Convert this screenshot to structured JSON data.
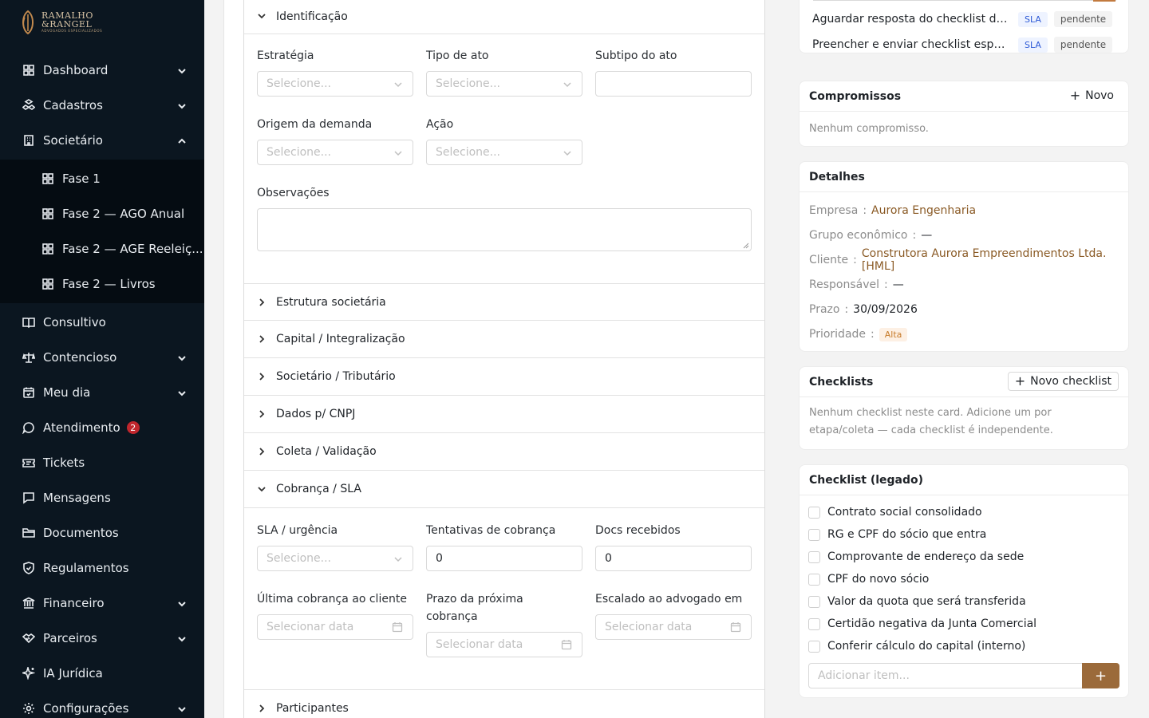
{
  "brand": {
    "name_line1": "RAMALHO",
    "name_line2": "&RANGEL",
    "tagline": "ADVOGADOS ESPECIALIZADOS"
  },
  "sidebar": {
    "items": [
      {
        "label": "Dashboard",
        "icon": "grid-icon",
        "chevron": "down"
      },
      {
        "label": "Cadastros",
        "icon": "boxes-icon",
        "chevron": "down"
      },
      {
        "label": "Societário",
        "icon": "building-icon",
        "chevron": "up"
      },
      {
        "label": "Fase 1",
        "icon": "grid-icon",
        "sub": true
      },
      {
        "label": "Fase 2 — AGO Anual",
        "icon": "grid-icon",
        "sub": true
      },
      {
        "label": "Fase 2 — AGE Reeleiç...",
        "icon": "grid-icon",
        "sub": true
      },
      {
        "label": "Fase 2 — Livros",
        "icon": "grid-icon",
        "sub": true
      },
      {
        "label": "Consultivo",
        "icon": "book-icon"
      },
      {
        "label": "Contencioso",
        "icon": "scale-icon",
        "chevron": "down"
      },
      {
        "label": "Meu dia",
        "icon": "calendar-icon",
        "chevron": "down"
      },
      {
        "label": "Atendimento",
        "icon": "chat-icon",
        "badge": "2"
      },
      {
        "label": "Tickets",
        "icon": "ticket-icon"
      },
      {
        "label": "Mensagens",
        "icon": "message-icon"
      },
      {
        "label": "Documentos",
        "icon": "folder-icon"
      },
      {
        "label": "Regulamentos",
        "icon": "shield-icon"
      },
      {
        "label": "Financeiro",
        "icon": "bank-icon",
        "chevron": "down"
      },
      {
        "label": "Parceiros",
        "icon": "handshake-icon",
        "chevron": "down"
      },
      {
        "label": "IA Jurídica",
        "icon": "sparkle-icon"
      },
      {
        "label": "Configurações",
        "icon": "gear-icon",
        "chevron": "down"
      }
    ]
  },
  "form": {
    "sections": {
      "identificacao": "Identificação",
      "estrutura": "Estrutura societária",
      "capital": "Capital / Integralização",
      "soc_trib": "Societário / Tributário",
      "dados_cnpj": "Dados p/ CNPJ",
      "coleta": "Coleta / Validação",
      "cobranca": "Cobrança / SLA",
      "participantes": "Participantes"
    },
    "labels": {
      "estrategia": "Estratégia",
      "tipo_ato": "Tipo de ato",
      "subtipo_ato": "Subtipo do ato",
      "origem": "Origem da demanda",
      "acao": "Ação",
      "observacoes": "Observações",
      "sla": "SLA / urgência",
      "tentativas": "Tentativas de cobrança",
      "docs": "Docs recebidos",
      "ultima": "Última cobrança ao cliente",
      "prazo_prox": "Prazo da próxima cobrança",
      "escalado": "Escalado ao advogado em"
    },
    "placeholders": {
      "select": "Selecione...",
      "date": "Selecionar data"
    },
    "values": {
      "tentativas": "0",
      "docs": "0"
    }
  },
  "tasks": [
    {
      "text": "Aguardar resposta do checklist do cli...",
      "sla": "SLA",
      "status": "pendente"
    },
    {
      "text": "Preencher e enviar checklist específi...",
      "sla": "SLA",
      "status": "pendente"
    }
  ],
  "compromissos": {
    "title": "Compromissos",
    "new_label": "Novo",
    "empty": "Nenhum compromisso."
  },
  "detalhes": {
    "title": "Detalhes",
    "empresa_key": "Empresa",
    "empresa": "Aurora Engenharia",
    "grupo_key": "Grupo econômico",
    "grupo": "—",
    "cliente_key": "Cliente",
    "cliente": "Construtora Aurora Empreendimentos Ltda. [HML]",
    "responsavel_key": "Responsável",
    "responsavel": "—",
    "prazo_key": "Prazo",
    "prazo": "30/09/2026",
    "prioridade_key": "Prioridade",
    "prioridade": "Alta",
    "colors": {
      "link": "#8a5a25",
      "alta": "#c77b2a"
    }
  },
  "checklists": {
    "title": "Checklists",
    "new_label": "Novo checklist",
    "empty": "Nenhum checklist neste card. Adicione um por etapa/coleta — cada checklist é independente."
  },
  "legado": {
    "title": "Checklist (legado)",
    "items": [
      "Contrato social consolidado",
      "RG e CPF do sócio que entra",
      "Comprovante de endereço da sede",
      "CPF do novo sócio",
      "Valor da quota que será transferida",
      "Certidão negativa da Junta Comercial",
      "Conferir cálculo do capital (interno)"
    ],
    "add_placeholder": "Adicionar item...",
    "accent": "#9b6a3a"
  }
}
